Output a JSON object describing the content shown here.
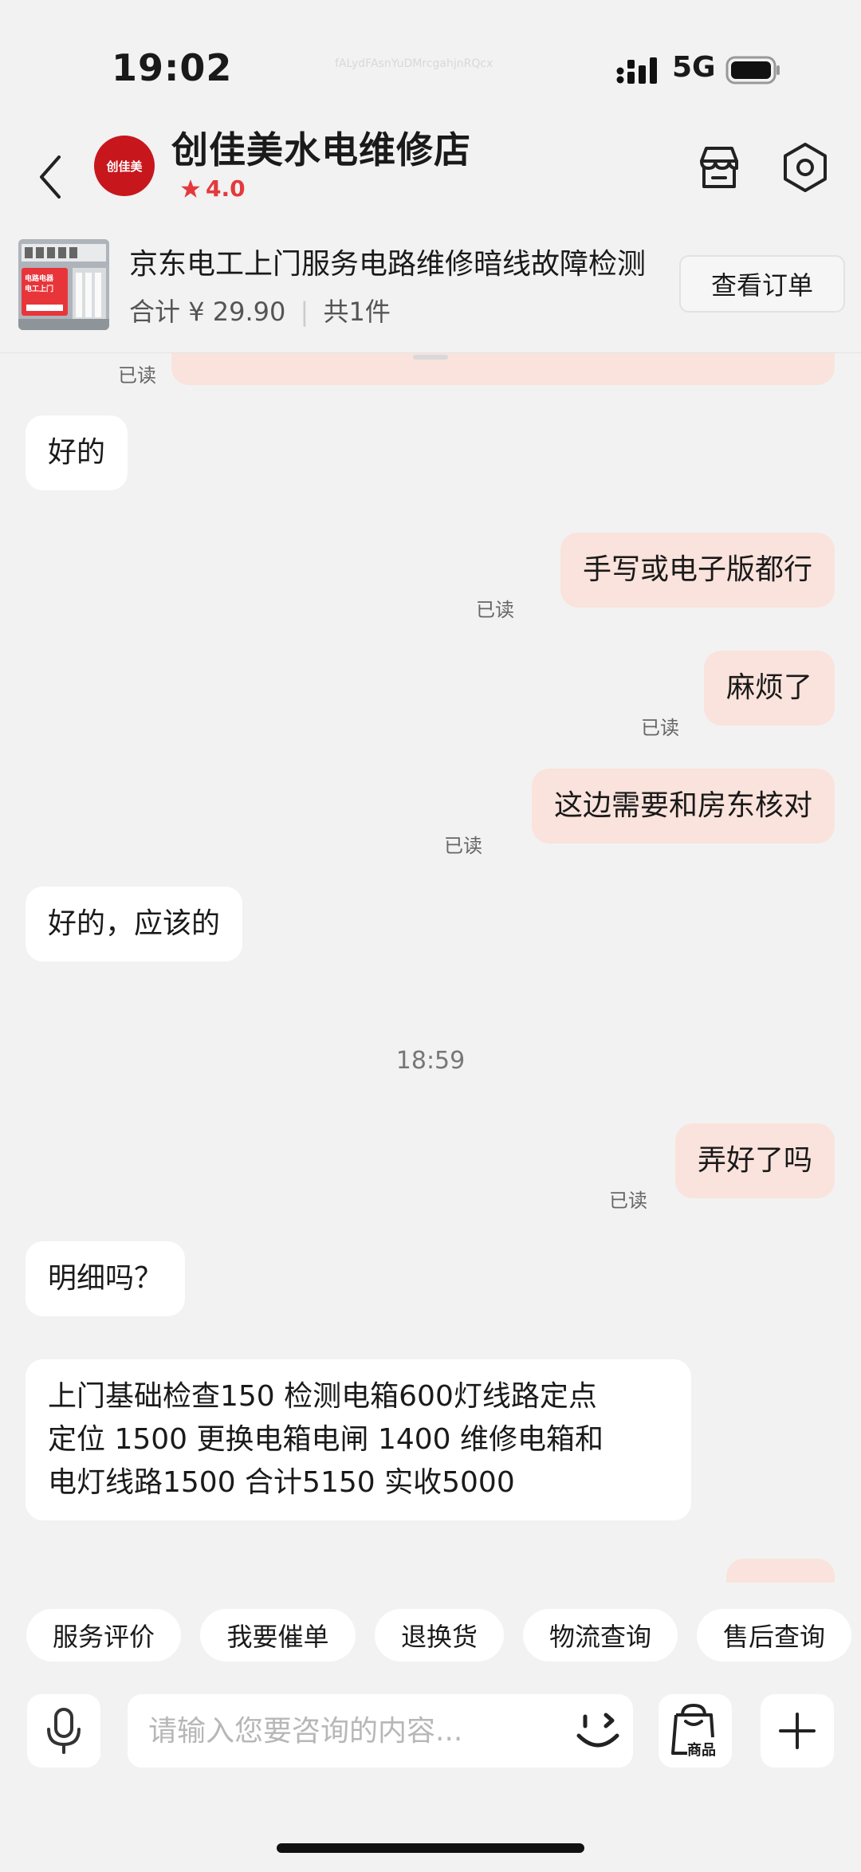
{
  "status_bar": {
    "time": "19:02",
    "watermark": "fALydFAsnYuDMrcgahjnRQcx",
    "network": "5G"
  },
  "header": {
    "shop_name": "创佳美水电维修店",
    "shop_logo_text": "创佳美",
    "rating": "4.0"
  },
  "order": {
    "title": "京东电工上门服务电路维修暗线故障检测",
    "total_label": "合计",
    "total_amount": "¥ 29.90",
    "count": "共1件",
    "view_button": "查看订单",
    "thumb_text": [
      "电路电器",
      "电工上门"
    ]
  },
  "chat": {
    "top_read": "已读",
    "messages": [
      {
        "id": "m1",
        "side": "in",
        "text": "好的"
      },
      {
        "id": "m2",
        "side": "out",
        "text": "手写或电子版都行",
        "read": "已读"
      },
      {
        "id": "m3",
        "side": "out",
        "text": "麻烦了",
        "read": "已读"
      },
      {
        "id": "m4",
        "side": "out",
        "text": "这边需要和房东核对",
        "read": "已读"
      },
      {
        "id": "m5",
        "side": "in",
        "text": "好的，应该的"
      },
      {
        "id": "m6",
        "side": "out",
        "text": "弄好了吗",
        "read": "已读"
      },
      {
        "id": "m7",
        "side": "in",
        "text": "明细吗？"
      },
      {
        "id": "m8",
        "side": "in",
        "lines": [
          "上门基础检查150 检测电箱600灯线路定点",
          "定位 1500 更换电箱电闸 1400 维修电箱和",
          "电灯线路1500 合计5150 实收5000"
        ]
      }
    ],
    "timestamp": "18:59"
  },
  "quick_actions": [
    "服务评价",
    "我要催单",
    "退换货",
    "物流查询",
    "售后查询"
  ],
  "input": {
    "placeholder": "请输入您要咨询的内容...",
    "goods_label": "商品"
  },
  "colors": {
    "accent": "#e4393c",
    "out_bubble": "#fae3dc",
    "in_bubble": "#ffffff",
    "background": "#f2f2f2"
  }
}
